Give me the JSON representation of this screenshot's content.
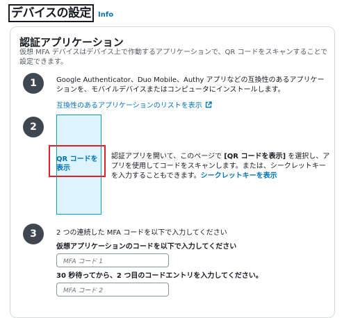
{
  "header": {
    "title": "デバイスの設定",
    "info": "Info"
  },
  "card": {
    "title": "認証アプリケーション",
    "description": "仮想 MFA デバイスはデバイス上で作動するアプリケーションで、QR コードをスキャンすることで設定できます。"
  },
  "steps": {
    "one": {
      "number": "1",
      "text": "Google Authenticator、Duo Mobile、Authy アプリなどの互換性のあるアプリケーションを、モバイルデバイスまたはコンピュータにインストールします。",
      "link": "互換性のあるアプリケーションのリストを表示"
    },
    "two": {
      "number": "2",
      "qr_label": "QR コードを表示",
      "text_a": "認証アプリを開いて、このページで ",
      "text_bold": "[QR コードを表示]",
      "text_b": " を選択し、アプリを使用してコードをスキャンします。または、シークレットキーを入力することもできます。",
      "secret_link": "シークレットキーを表示"
    },
    "three": {
      "number": "3",
      "intro": "2 つの連続した MFA コードを以下で入力してください",
      "field1_label": "仮想アプリケーションのコードを以下で入力してください",
      "field1_placeholder": "MFA コード 1",
      "field2_label": "30 秒待ってから、2 つ目のコードエントリを入力してください。",
      "field2_placeholder": "MFA コード 2"
    }
  }
}
